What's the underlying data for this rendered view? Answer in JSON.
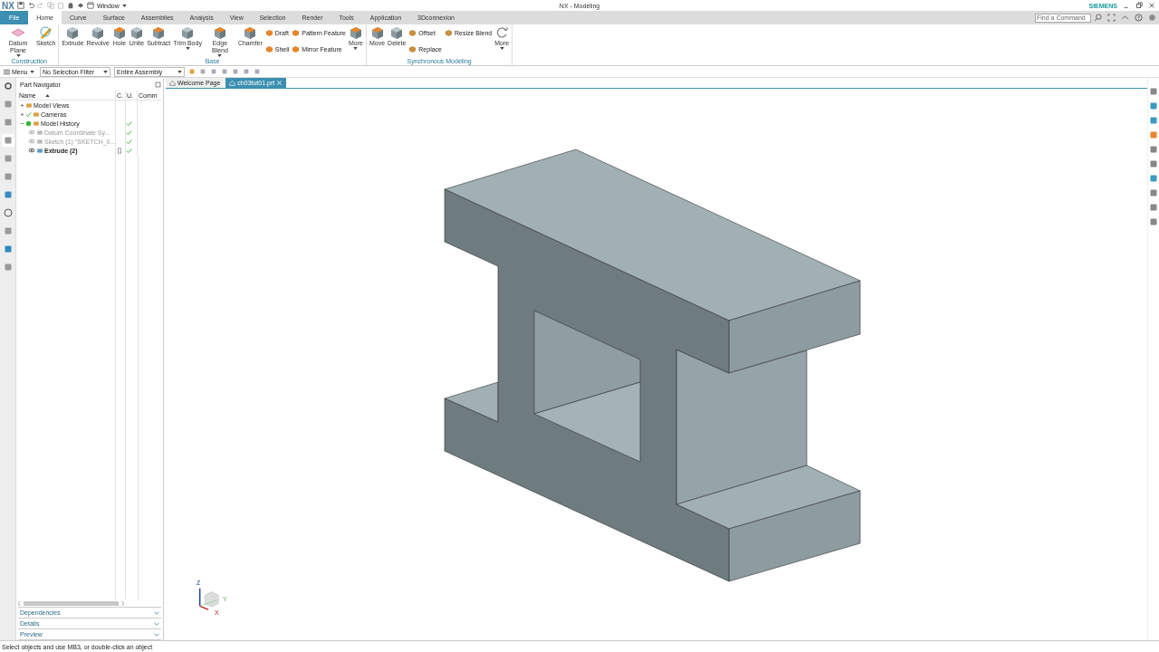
{
  "title_bar": {
    "logo": "NX",
    "window_menu": "Window",
    "title": "NX - Modeling",
    "brand": "SIEMENS"
  },
  "menu_tabs": [
    {
      "label": "File",
      "kind": "file",
      "selected": false
    },
    {
      "label": "Home",
      "kind": "tab",
      "selected": true
    },
    {
      "label": "Curve",
      "kind": "tab",
      "selected": false
    },
    {
      "label": "Surface",
      "kind": "tab",
      "selected": false
    },
    {
      "label": "Assemblies",
      "kind": "tab",
      "selected": false
    },
    {
      "label": "Analysis",
      "kind": "tab",
      "selected": false
    },
    {
      "label": "View",
      "kind": "tab",
      "selected": false
    },
    {
      "label": "Selection",
      "kind": "tab",
      "selected": false
    },
    {
      "label": "Render",
      "kind": "tab",
      "selected": false
    },
    {
      "label": "Tools",
      "kind": "tab",
      "selected": false
    },
    {
      "label": "Application",
      "kind": "tab",
      "selected": false
    },
    {
      "label": "3Dconnexion",
      "kind": "tab",
      "selected": false
    }
  ],
  "command_search": {
    "placeholder": "Find a Command"
  },
  "ribbon_groups": [
    {
      "name": "Construction",
      "items": [
        {
          "kind": "large",
          "label": "Datum Plane",
          "dropdown": true
        },
        {
          "kind": "large",
          "label": "Sketch",
          "dropdown": false
        }
      ]
    },
    {
      "name": "Base",
      "items": [
        {
          "kind": "large",
          "label": "Extrude",
          "dropdown": false
        },
        {
          "kind": "large",
          "label": "Revolve",
          "dropdown": false
        },
        {
          "kind": "large",
          "label": "Hole",
          "dropdown": false
        },
        {
          "kind": "large",
          "label": "Unite",
          "dropdown": false
        },
        {
          "kind": "large",
          "label": "Subtract",
          "dropdown": false
        },
        {
          "kind": "large",
          "label": "Trim Body",
          "dropdown": true
        },
        {
          "kind": "large",
          "label": "Edge Blend",
          "dropdown": true
        },
        {
          "kind": "large",
          "label": "Chamfer",
          "dropdown": false
        },
        {
          "kind": "small",
          "label": "Draft",
          "dropdown": false
        },
        {
          "kind": "small",
          "label": "Shell",
          "dropdown": false
        },
        {
          "kind": "small",
          "label": "Pattern Feature",
          "dropdown": false
        },
        {
          "kind": "small",
          "label": "Mirror Feature",
          "dropdown": false
        },
        {
          "kind": "large",
          "label": "More",
          "dropdown": true
        }
      ]
    },
    {
      "name": "Synchronous Modeling",
      "items": [
        {
          "kind": "large",
          "label": "Move",
          "dropdown": false
        },
        {
          "kind": "large",
          "label": "Delete",
          "dropdown": false
        },
        {
          "kind": "small",
          "label": "Offset",
          "dropdown": false
        },
        {
          "kind": "small",
          "label": "Replace",
          "dropdown": false
        },
        {
          "kind": "small",
          "label": "Resize Blend",
          "dropdown": false
        },
        {
          "kind": "large",
          "label": "More",
          "dropdown": true
        }
      ]
    }
  ],
  "selection_bar": {
    "menu": "Menu",
    "filter": "No Selection Filter",
    "scope": "Entire Assembly"
  },
  "document_tabs": [
    {
      "label": "Welcome Page",
      "selected": false
    },
    {
      "label": "ch03tut01.prt",
      "selected": true
    }
  ],
  "navigator": {
    "title": "Part Navigator",
    "columns": [
      "Name",
      "C.",
      "U.",
      "Comm"
    ],
    "tree": [
      {
        "label": "Model Views",
        "expanded": false,
        "visible": false,
        "up_to_date": false,
        "disabled": false,
        "current": false
      },
      {
        "label": "Cameras",
        "expanded": false,
        "visible": true,
        "up_to_date": false,
        "disabled": false,
        "current": false
      },
      {
        "label": "Model History",
        "expanded": true,
        "visible": false,
        "up_to_date": true,
        "disabled": false,
        "current": false,
        "children": [
          {
            "label": "Datum Coordinate Sy...",
            "visible": false,
            "up_to_date": true,
            "disabled": true,
            "current": false
          },
          {
            "label": "Sketch (1) \"SKETCH_0...",
            "visible": false,
            "up_to_date": true,
            "disabled": true,
            "current": false
          },
          {
            "label": "Extrude (2)",
            "visible": false,
            "up_to_date": true,
            "disabled": false,
            "current": true
          }
        ]
      }
    ],
    "panels": [
      "Dependencies",
      "Details",
      "Preview"
    ]
  },
  "triad": {
    "axes": [
      "Z",
      "Y",
      "X"
    ]
  },
  "status_bar": "Select objects and use MB3, or double-click an object"
}
